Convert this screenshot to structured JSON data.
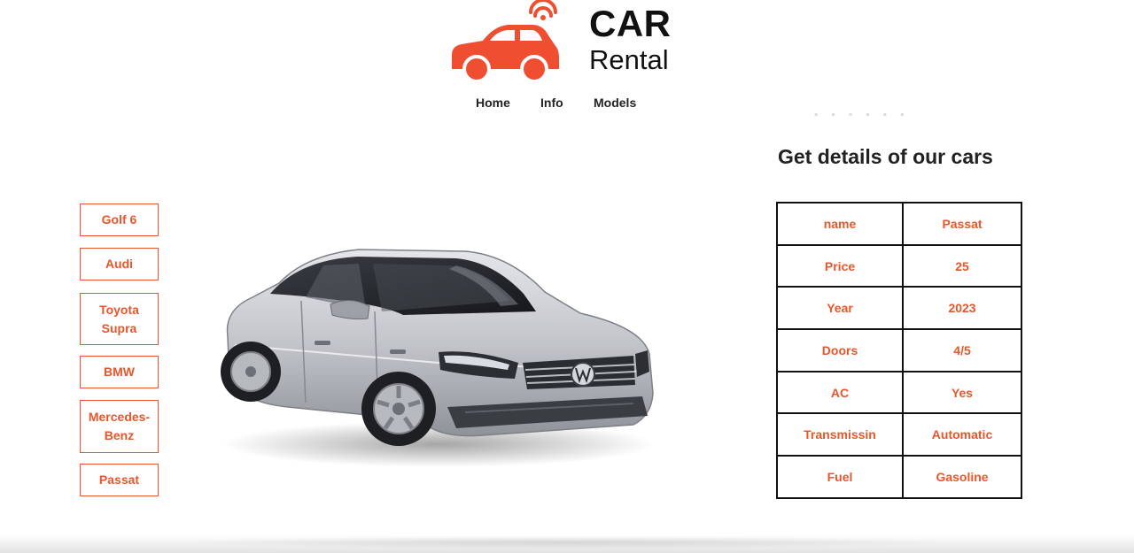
{
  "brand": {
    "title": "CAR",
    "subtitle": "Rental",
    "accent_color": "#f04e31",
    "logo_icon": "car-wifi-icon"
  },
  "nav": {
    "items": [
      "Home",
      "Info",
      "Models"
    ]
  },
  "models": {
    "items": [
      "Golf 6",
      "Audi",
      "Toyota Supra",
      "BMW",
      "Mercedes-Benz",
      "Passat"
    ],
    "selected": "Passat"
  },
  "car_image": {
    "icon": "silver-sedan-image"
  },
  "details": {
    "title": "Get details of our cars",
    "rows": [
      {
        "key": "name",
        "value": "Passat"
      },
      {
        "key": "Price",
        "value": "25"
      },
      {
        "key": "Year",
        "value": "2023"
      },
      {
        "key": "Doors",
        "value": "4/5"
      },
      {
        "key": "AC",
        "value": "Yes"
      },
      {
        "key": "Transmissin",
        "value": "Automatic"
      },
      {
        "key": "Fuel",
        "value": "Gasoline"
      }
    ]
  }
}
